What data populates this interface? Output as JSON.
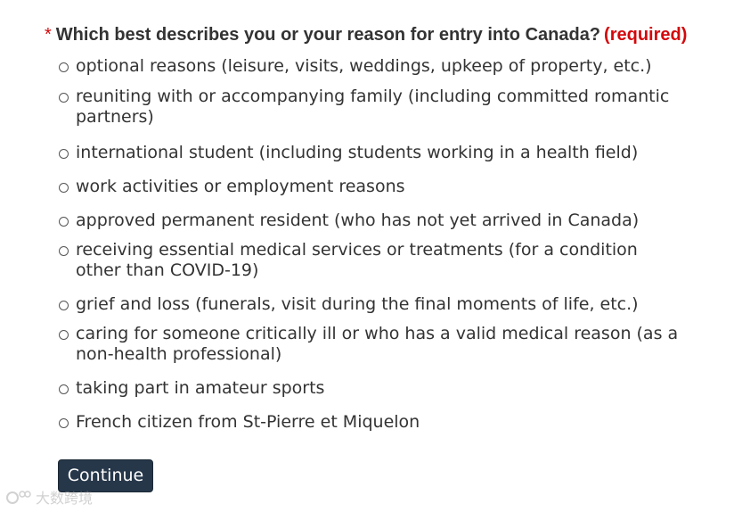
{
  "question": {
    "asterisk": "*",
    "text": "Which best describes you or your reason for entry into Canada?",
    "required": "(required)"
  },
  "options": [
    {
      "label": "optional reasons (leisure, visits, weddings, upkeep of property, etc.)",
      "selected": false
    },
    {
      "label": "reuniting with or accompanying family (including committed romantic partners)",
      "selected": false
    },
    {
      "label": "international student (including students working in a health field)",
      "selected": false
    },
    {
      "label": "work activities or employment reasons",
      "selected": false
    },
    {
      "label": "approved permanent resident (who has not yet arrived in Canada)",
      "selected": false
    },
    {
      "label": "receiving essential medical services or treatments (for a condition other than COVID-19)",
      "selected": false
    },
    {
      "label": "grief and loss (funerals, visit during the final moments of life, etc.)",
      "selected": false
    },
    {
      "label": "caring for someone critically ill or who has a valid medical reason (as a non-health professional)",
      "selected": false
    },
    {
      "label": "taking part in amateur sports",
      "selected": false
    },
    {
      "label": "French citizen from St-Pierre et Miquelon",
      "selected": false
    }
  ],
  "continue_button": {
    "label": "Continue"
  },
  "watermark": {
    "text": "大数跨境"
  },
  "colors": {
    "required_red": "#d3080c",
    "button_navy": "#26374a",
    "text": "#333333"
  }
}
